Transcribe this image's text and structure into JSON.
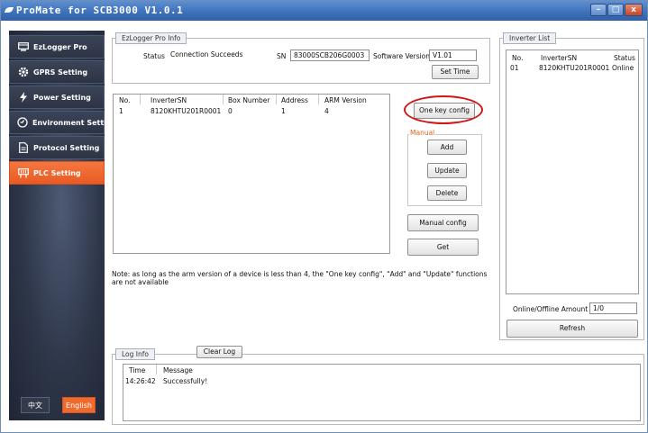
{
  "window": {
    "title": "ProMate for SCB3000 V1.0.1",
    "min": "–",
    "max": "□",
    "close": "x"
  },
  "sidebar": {
    "items": [
      {
        "label": "EzLogger Pro",
        "icon": "monitor-icon",
        "active": false
      },
      {
        "label": "GPRS Setting",
        "icon": "gear-icon",
        "active": false
      },
      {
        "label": "Power Setting",
        "icon": "lightning-icon",
        "active": false
      },
      {
        "label": "Environment Setting",
        "icon": "dial-icon",
        "active": false
      },
      {
        "label": "Protocol Setting",
        "icon": "document-icon",
        "active": false
      },
      {
        "label": "PLC Setting",
        "icon": "plug-icon",
        "active": true
      }
    ],
    "lang_cn": "中文",
    "lang_en": "English",
    "accent": "#ef6a2f"
  },
  "ezlogger": {
    "tab": "EzLogger Pro Info",
    "status_label": "Status",
    "status_value": "Connection Succeeds",
    "sn_label": "SN",
    "sn_value": "83000SCB206G0003",
    "sw_label": "Software Version",
    "sw_value": "V1.01",
    "set_time": "Set Time"
  },
  "device_table": {
    "headers": [
      "No.",
      "InverterSN",
      "Box Number",
      "Address",
      "ARM Version"
    ],
    "rows": [
      [
        "1",
        "8120KHTU201R0001",
        "0",
        "1",
        "4"
      ]
    ]
  },
  "actions": {
    "one_key": "One key config",
    "manual_legend": "Manual",
    "add": "Add",
    "update": "Update",
    "delete": "Delete",
    "manual_config": "Manual config",
    "get": "Get"
  },
  "note": "Note: as long as the arm version of a device is less than 4, the \"One key config\", \"Add\" and \"Update\" functions are not available",
  "inverter_list": {
    "tab": "Inverter List",
    "headers": [
      "No.",
      "InverterSN",
      "Status"
    ],
    "rows": [
      [
        "01",
        "8120KHTU201R0001",
        "Online"
      ]
    ],
    "amount_label": "Online/Offline Amount",
    "amount_value": "1/0",
    "refresh": "Refresh"
  },
  "log": {
    "tab": "Log Info",
    "clear": "Clear Log",
    "headers": [
      "Time",
      "Message"
    ],
    "rows": [
      [
        "14:26:42",
        "Successfully!"
      ]
    ]
  }
}
